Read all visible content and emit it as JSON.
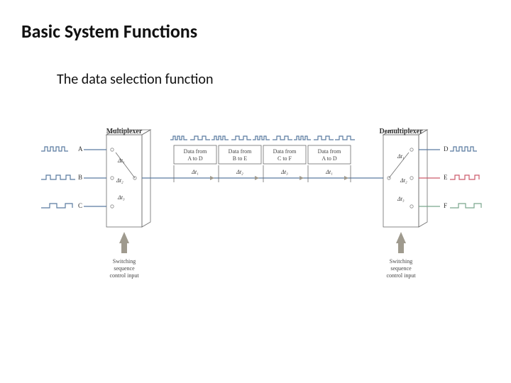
{
  "title": "Basic System Functions",
  "subtitle": "The data selection function",
  "mux": {
    "label": "Multiplexer",
    "dt1": "Δt₁",
    "dt2": "Δt₂",
    "dt3": "Δt₃"
  },
  "demux": {
    "label": "Demultiplexer",
    "dt1": "Δt₁",
    "dt2": "Δt₂",
    "dt3": "Δt₃"
  },
  "inputs": {
    "A": "A",
    "B": "B",
    "C": "C"
  },
  "outputs": {
    "D": "D",
    "E": "E",
    "F": "F"
  },
  "segments": {
    "s1": {
      "l1": "Data from",
      "l2": "A to D",
      "dt": "Δt₁"
    },
    "s2": {
      "l1": "Data from",
      "l2": "B to E",
      "dt": "Δt₂"
    },
    "s3": {
      "l1": "Data from",
      "l2": "C to F",
      "dt": "Δt₃"
    },
    "s4": {
      "l1": "Data from",
      "l2": "A to D",
      "dt": "Δt₁"
    }
  },
  "ctrl": {
    "l1": "Switching",
    "l2": "sequence",
    "l3": "control input"
  }
}
